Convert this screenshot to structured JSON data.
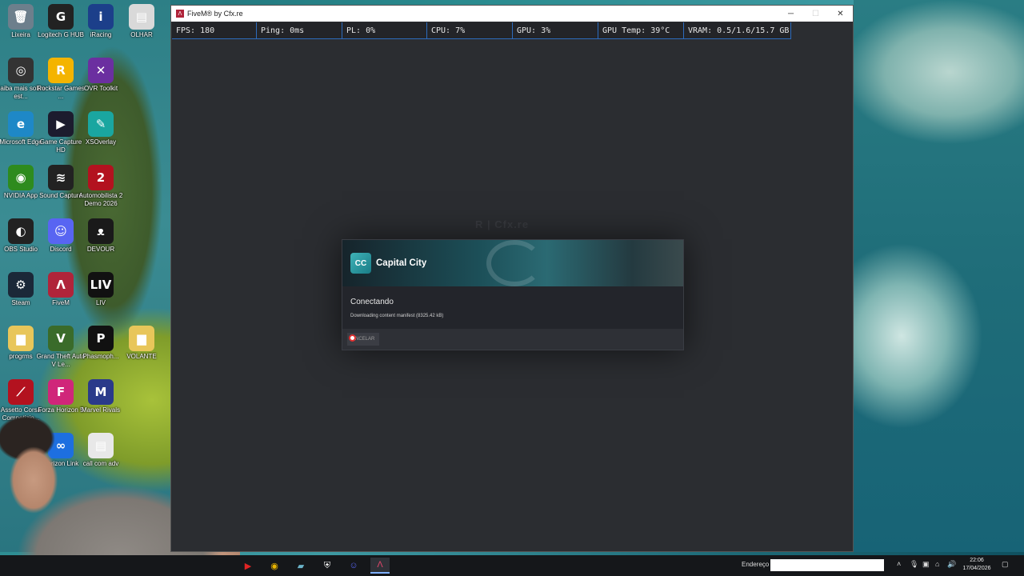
{
  "desktop": {
    "icons": [
      {
        "label": "Lixeira",
        "icon": "recycle-bin-icon",
        "glyph": "🗑",
        "color": "#6d7f8c"
      },
      {
        "label": "Logitech G HUB",
        "icon": "logitech-g-icon",
        "glyph": "G",
        "color": "#222"
      },
      {
        "label": "iRacing",
        "icon": "iracing-icon",
        "glyph": "i",
        "color": "#1c3f8a"
      },
      {
        "label": "OLHAR",
        "icon": "text-file-icon",
        "glyph": "▤",
        "color": "#d9d9d9"
      },
      {
        "label": "Saiba mais sobre est...",
        "icon": "info-icon",
        "glyph": "◎",
        "color": "#333"
      },
      {
        "label": "Rockstar Games ...",
        "icon": "rockstar-icon",
        "glyph": "R",
        "color": "#f4b400"
      },
      {
        "label": "OVR Toolkit",
        "icon": "ovr-toolkit-icon",
        "glyph": "✕",
        "color": "#6b2fa0"
      },
      {
        "label": "Microsoft Edge",
        "icon": "edge-icon",
        "glyph": "e",
        "color": "#1e88c7"
      },
      {
        "label": "Game Capture HD",
        "icon": "game-capture-icon",
        "glyph": "▶",
        "color": "#1c1c2e"
      },
      {
        "label": "XSOverlay",
        "icon": "xsoverlay-icon",
        "glyph": "✎",
        "color": "#1aa6a0"
      },
      {
        "label": "NVIDIA App",
        "icon": "nvidia-icon",
        "glyph": "◉",
        "color": "#2e8b1e"
      },
      {
        "label": "Sound Capture",
        "icon": "sound-capture-icon",
        "glyph": "≋",
        "color": "#222"
      },
      {
        "label": "Automobilista 2 Demo 2026",
        "icon": "automobilista-icon",
        "glyph": "2",
        "color": "#b3121f"
      },
      {
        "label": "OBS Studio",
        "icon": "obs-icon",
        "glyph": "◐",
        "color": "#222"
      },
      {
        "label": "Discord",
        "icon": "discord-icon",
        "glyph": "☺",
        "color": "#5865f2"
      },
      {
        "label": "DEVOUR",
        "icon": "devour-icon",
        "glyph": "ᴥ",
        "color": "#1a1a1a"
      },
      {
        "label": "Steam",
        "icon": "steam-icon",
        "glyph": "⚙",
        "color": "#1b2838"
      },
      {
        "label": "FiveM",
        "icon": "fivem-icon",
        "glyph": "Λ",
        "color": "#b0243a"
      },
      {
        "label": "LIV",
        "icon": "liv-icon",
        "glyph": "LIV",
        "color": "#111"
      },
      {
        "label": "progrms",
        "icon": "folder-icon",
        "glyph": "▆",
        "color": "#e8c65a"
      },
      {
        "label": "Grand Theft Auto V Le...",
        "icon": "gta-v-icon",
        "glyph": "V",
        "color": "#3a6b2a"
      },
      {
        "label": "Phasmoph...",
        "icon": "phasmophobia-icon",
        "glyph": "P",
        "color": "#111"
      },
      {
        "label": "VOLANTE",
        "icon": "folder-icon",
        "glyph": "▆",
        "color": "#e8c65a"
      },
      {
        "label": "Assetto Corsa Competizio...",
        "icon": "assetto-corsa-icon",
        "glyph": "⟋",
        "color": "#b3121f"
      },
      {
        "label": "Forza Horizon 5",
        "icon": "forza-icon",
        "glyph": "F",
        "color": "#d0267a"
      },
      {
        "label": "Marvel Rivals",
        "icon": "marvel-rivals-icon",
        "glyph": "M",
        "color": "#2a3a8a"
      },
      {
        "label": "Horizon Link",
        "icon": "meta-icon",
        "glyph": "∞",
        "color": "#1d6fe0"
      },
      {
        "label": "call com adv",
        "icon": "document-icon",
        "glyph": "▤",
        "color": "#e8e8e8"
      }
    ]
  },
  "window": {
    "title": "FiveM® by Cfx.re",
    "controls": {
      "minimize": "─",
      "maximize": "☐",
      "close": "✕"
    }
  },
  "stats": [
    {
      "label": "FPS: 180",
      "w": 106
    },
    {
      "label": "Ping: 0ms",
      "w": 107
    },
    {
      "label": "PL: 0%",
      "w": 106
    },
    {
      "label": "CPU: 7%",
      "w": 107
    },
    {
      "label": "GPU: 3%",
      "w": 107
    },
    {
      "label": "GPU Temp: 39°C",
      "w": 107
    },
    {
      "label": "VRAM: 0.5/1.6/15.7 GB",
      "w": 134
    }
  ],
  "background_logo": "R | Cfx.re",
  "dialog": {
    "server_name": "Capital City",
    "server_logo_text": "CC",
    "state": "Conectando",
    "detail": "Downloading content manifest (8325.42 kB)",
    "cancel_label": "NCELAR"
  },
  "taskbar": {
    "apps": [
      {
        "icon": "youtube-icon",
        "glyph": "▶",
        "color": "#e02424"
      },
      {
        "icon": "chrome-icon",
        "glyph": "◉",
        "color": "#e8b400"
      },
      {
        "icon": "notes-icon",
        "glyph": "▰",
        "color": "#6bb3c9"
      },
      {
        "icon": "shield-icon",
        "glyph": "⛨",
        "color": "#ffffff"
      },
      {
        "icon": "discord-icon",
        "glyph": "☺",
        "color": "#5865f2"
      },
      {
        "icon": "fivem-icon",
        "glyph": "Λ",
        "color": "#e0466a"
      }
    ],
    "address_label": "Endereço",
    "address_value": "",
    "clock_time": "22:06",
    "clock_date": "17/04/2026"
  }
}
